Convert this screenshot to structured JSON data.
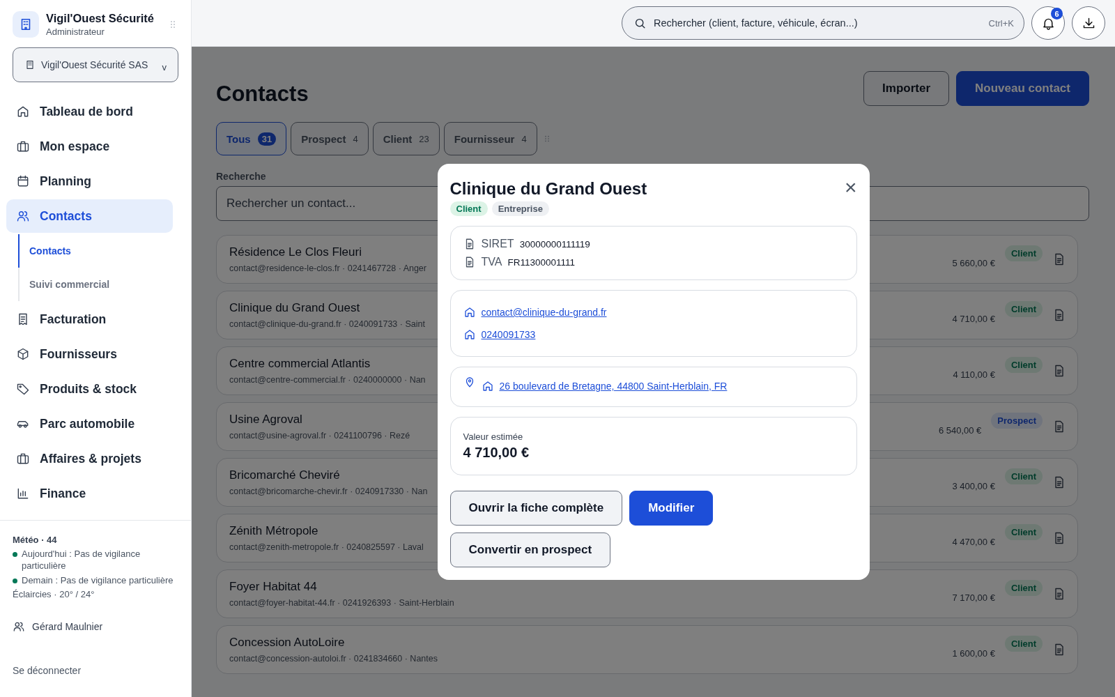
{
  "sidebar": {
    "brand": {
      "title": "Vigil'Ouest Sécurité",
      "subtitle": "Administrateur"
    },
    "org_select": {
      "value": "Vigil'Ouest Sécurité SAS",
      "caret": "v"
    },
    "nav": [
      {
        "label": "Tableau de bord",
        "selected": false
      },
      {
        "label": "Mon espace",
        "selected": false
      },
      {
        "label": "Planning",
        "selected": false
      },
      {
        "label": "Contacts",
        "selected": true,
        "children": [
          {
            "label": "Contacts",
            "selected": true
          },
          {
            "label": "Suivi commercial",
            "selected": false
          }
        ]
      },
      {
        "label": "Facturation",
        "selected": false
      },
      {
        "label": "Fournisseurs",
        "selected": false
      },
      {
        "label": "Produits & stock",
        "selected": false
      },
      {
        "label": "Parc automobile",
        "selected": false
      },
      {
        "label": "Affaires & projets",
        "selected": false
      },
      {
        "label": "Finance",
        "selected": false
      }
    ],
    "weather": {
      "title": "Météo · 44",
      "alerts": [
        {
          "text": "Aujourd'hui : Pas de vigilance particulière",
          "color": "#047857"
        },
        {
          "text": "Demain : Pas de vigilance particulière",
          "color": "#047857"
        }
      ],
      "forecast": "Éclaircies · 20° / 24°"
    },
    "user": "Gérard Maulnier",
    "logout": "Se déconnecter"
  },
  "topbar": {
    "search": {
      "placeholder": "Rechercher (client, facture, véhicule, écran...)",
      "shortcut": "Ctrl+K"
    },
    "notifications": "6"
  },
  "page": {
    "title": "Contacts",
    "buttons": [
      {
        "label": "Importer",
        "kind": "secondary"
      },
      {
        "label": "Nouveau contact",
        "kind": "primary"
      }
    ],
    "filters": [
      {
        "label": "Tous",
        "count": "31",
        "selected": true
      },
      {
        "label": "Prospect",
        "count": "4",
        "selected": false
      },
      {
        "label": "Client",
        "count": "23",
        "selected": false
      },
      {
        "label": "Fournisseur",
        "count": "4",
        "selected": false
      }
    ],
    "search": {
      "label": "Recherche",
      "placeholder": "Rechercher un contact..."
    },
    "contacts": [
      {
        "name": "Résidence Le Clos Fleuri",
        "details": "contact@residence-le-clos.fr · 0241467728 · Anger",
        "amount": "5 660,00 €",
        "tag": "Client",
        "kind": "client"
      },
      {
        "name": "Clinique du Grand Ouest",
        "details": "contact@clinique-du-grand.fr · 0240091733 · Saint",
        "amount": "4 710,00 €",
        "tag": "Client",
        "kind": "client"
      },
      {
        "name": "Centre commercial Atlantis",
        "details": "contact@centre-commercial.fr · 0240000000 · Nan",
        "amount": "4 110,00 €",
        "tag": "Client",
        "kind": "client"
      },
      {
        "name": "Usine Agroval",
        "details": "contact@usine-agroval.fr · 0241100796 · Rezé",
        "amount": "6 540,00 €",
        "tag": "Prospect",
        "kind": "prospect"
      },
      {
        "name": "Bricomarché Cheviré",
        "details": "contact@bricomarche-chevir.fr · 0240917330 · Nan",
        "amount": "3 400,00 €",
        "tag": "Client",
        "kind": "client"
      },
      {
        "name": "Zénith Métropole",
        "details": "contact@zenith-metropole.fr · 0240825597 · Laval",
        "amount": "4 470,00 €",
        "tag": "Client",
        "kind": "client"
      },
      {
        "name": "Foyer Habitat 44",
        "details": "contact@foyer-habitat-44.fr · 0241926393 · Saint-Herblain",
        "amount": "7 170,00 €",
        "tag": "Client",
        "kind": "client"
      },
      {
        "name": "Concession AutoLoire",
        "details": "contact@concession-autoloi.fr · 0241834660 · Nantes",
        "amount": "1 600,00 €",
        "tag": "Client",
        "kind": "client"
      }
    ]
  },
  "modal": {
    "title": "Clinique du Grand Ouest",
    "close": "×",
    "tags": [
      {
        "label": "Client",
        "kind": "client"
      },
      {
        "label": "Entreprise",
        "kind": "neutral"
      }
    ],
    "ids": [
      {
        "label": "SIRET",
        "value": "30000000111119"
      },
      {
        "label": "TVA",
        "value": "FR11300001111"
      }
    ],
    "links": [
      "contact@clinique-du-grand.fr",
      "0240091733"
    ],
    "address": "26 boulevard de Bretagne, 44800 Saint-Herblain, FR",
    "estimate": {
      "label": "Valeur estimée",
      "value": "4 710,00 €"
    },
    "buttons": [
      {
        "label": "Ouvrir la fiche complète",
        "kind": "secondary"
      },
      {
        "label": "Modifier",
        "kind": "primary"
      },
      {
        "label": "Convertir en prospect",
        "kind": "secondary"
      }
    ]
  }
}
